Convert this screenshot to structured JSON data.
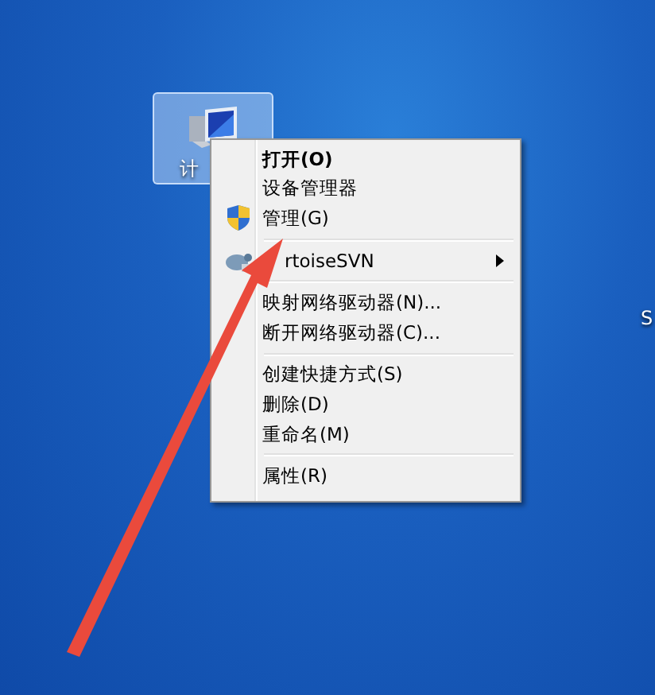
{
  "desktop": {
    "icons": [
      {
        "label": "计",
        "selected": true
      },
      {
        "label": "S"
      }
    ]
  },
  "context_menu": {
    "items": [
      {
        "kind": "plain",
        "label": "打开(O)",
        "default": true
      },
      {
        "kind": "plain",
        "label": "设备管理器",
        "default": false
      },
      {
        "kind": "shield",
        "label": "管理(G)",
        "default": false
      },
      {
        "kind": "separator"
      },
      {
        "kind": "svn",
        "label": "rtoiseSVN",
        "default": false,
        "submenu": true
      },
      {
        "kind": "separator"
      },
      {
        "kind": "plain",
        "label": "映射网络驱动器(N)...",
        "default": false
      },
      {
        "kind": "plain",
        "label": "断开网络驱动器(C)...",
        "default": false
      },
      {
        "kind": "separator"
      },
      {
        "kind": "plain",
        "label": "创建快捷方式(S)",
        "default": false
      },
      {
        "kind": "plain",
        "label": "删除(D)",
        "default": false
      },
      {
        "kind": "plain",
        "label": "重命名(M)",
        "default": false
      },
      {
        "kind": "separator"
      },
      {
        "kind": "plain",
        "label": "属性(R)",
        "default": false
      }
    ]
  }
}
